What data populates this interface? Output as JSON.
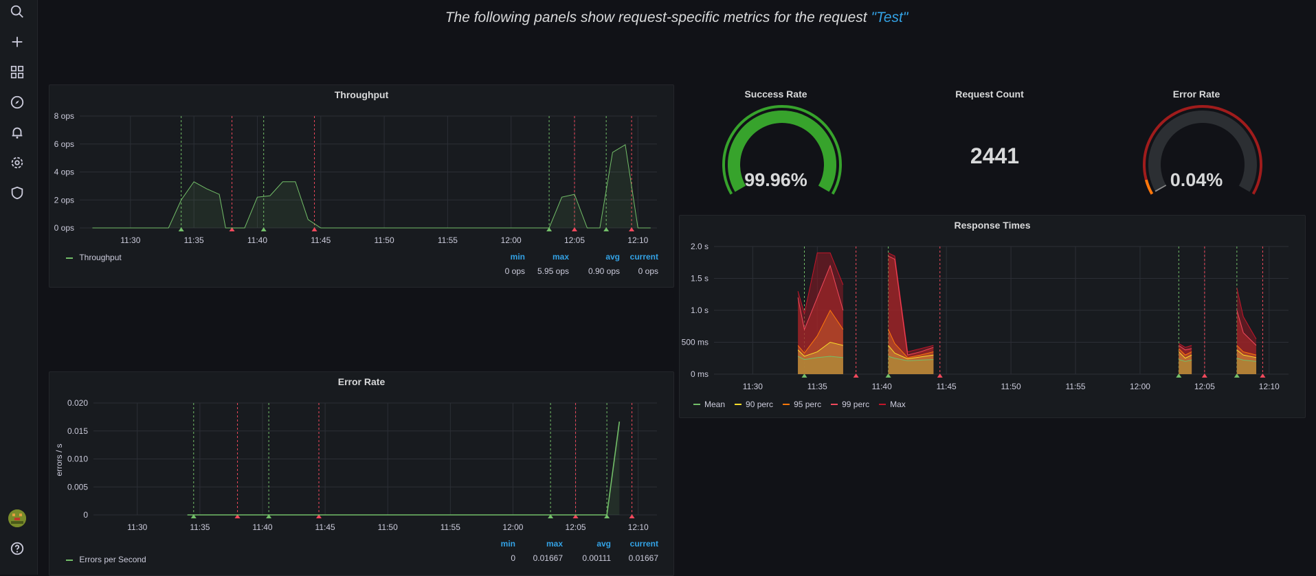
{
  "header": {
    "prefix": "The following panels show request-specific metrics for the request ",
    "request_name": "\"Test\""
  },
  "sidebar": {
    "items": [
      {
        "icon": "search-icon"
      },
      {
        "icon": "plus-icon"
      },
      {
        "icon": "dashboards-icon"
      },
      {
        "icon": "explore-icon"
      },
      {
        "icon": "alerting-bell-icon"
      },
      {
        "icon": "gear-icon"
      },
      {
        "icon": "shield-icon"
      }
    ],
    "bottom": [
      {
        "icon": "avatar"
      },
      {
        "icon": "help-icon"
      }
    ]
  },
  "colors": {
    "green": "#73bf69",
    "red": "#f2495c",
    "blue": "#33a2e5",
    "gauge_green": "#37a32c",
    "gauge_red": "#a01c1c",
    "gauge_orange": "#ff780a"
  },
  "time_ticks": [
    "11:30",
    "11:35",
    "11:40",
    "11:45",
    "11:50",
    "11:55",
    "12:00",
    "12:05",
    "12:10"
  ],
  "throughput": {
    "title": "Throughput",
    "legend": {
      "headers": [
        "min",
        "max",
        "avg",
        "current"
      ],
      "series_name": "Throughput",
      "values": [
        "0 ops",
        "5.95 ops",
        "0.90 ops",
        "0 ops"
      ]
    },
    "chart_data": {
      "type": "area",
      "y_ticks": [
        "0 ops",
        "2 ops",
        "4 ops",
        "6 ops",
        "8 ops"
      ],
      "ylim": [
        0,
        8
      ],
      "x": [
        "11:27:00",
        "11:33:00",
        "11:34:00",
        "11:35:00",
        "11:36:00",
        "11:37:00",
        "11:37:30",
        "11:38:00",
        "11:39:00",
        "11:40:00",
        "11:41:00",
        "11:42:00",
        "11:43:00",
        "11:44:00",
        "11:45:00",
        "11:46:00",
        "12:02:00",
        "12:03:00",
        "12:04:00",
        "12:05:00",
        "12:06:00",
        "12:07:00",
        "12:08:00",
        "12:09:00",
        "12:10:00",
        "12:11:00"
      ],
      "series": [
        {
          "name": "Throughput",
          "values": [
            0,
            0,
            2.0,
            3.3,
            2.8,
            2.4,
            0,
            0,
            0,
            2.2,
            2.3,
            3.3,
            3.3,
            0.6,
            0,
            0,
            0,
            0,
            2.2,
            2.4,
            0,
            0,
            5.4,
            5.95,
            0,
            0
          ]
        }
      ],
      "annotations_green": [
        "11:34:00",
        "11:40:30",
        "12:03:00",
        "12:07:30"
      ],
      "annotations_red": [
        "11:38:00",
        "11:44:30",
        "12:05:00",
        "12:09:30"
      ]
    }
  },
  "error_rate": {
    "title": "Error Rate",
    "ylabel": "errors / s",
    "legend": {
      "headers": [
        "min",
        "max",
        "avg",
        "current"
      ],
      "series_name": "Errors per Second",
      "values": [
        "0",
        "0.01667",
        "0.00111",
        "0.01667"
      ]
    },
    "chart_data": {
      "type": "line",
      "y_ticks": [
        "0",
        "0.005",
        "0.010",
        "0.015",
        "0.020"
      ],
      "ylim": [
        0,
        0.02
      ],
      "x": [
        "11:34:00",
        "12:07:30",
        "12:08:30"
      ],
      "series": [
        {
          "name": "Errors per Second",
          "values": [
            0,
            0,
            0.01667
          ]
        }
      ],
      "annotations_green": [
        "11:34:30",
        "11:40:30",
        "12:03:00",
        "12:07:30"
      ],
      "annotations_red": [
        "11:38:00",
        "11:44:30",
        "12:05:00",
        "12:09:30"
      ]
    }
  },
  "success_rate": {
    "title": "Success Rate",
    "value": "99.96%",
    "fraction": 0.9996
  },
  "request_count": {
    "title": "Request Count",
    "value": "2441"
  },
  "error_rate_gauge": {
    "title": "Error Rate",
    "value": "0.04%",
    "fraction": 0.0004
  },
  "response_times": {
    "title": "Response Times",
    "legend": [
      "Mean",
      "90 perc",
      "95 perc",
      "99 perc",
      "Max"
    ],
    "legend_colors": [
      "#73bf69",
      "#fade2a",
      "#ff780a",
      "#f2495c",
      "#c4162a"
    ],
    "chart_data": {
      "type": "area",
      "y_ticks": [
        "0 ms",
        "500 ms",
        "1.0 s",
        "1.5 s",
        "2.0 s"
      ],
      "ylim": [
        0,
        2000
      ],
      "x": [
        "11:33:30",
        "11:34:00",
        "11:35:00",
        "11:36:00",
        "11:37:00",
        "11:37:30",
        "11:40:30",
        "11:41:00",
        "11:42:00",
        "11:43:00",
        "11:44:00",
        "11:44:30",
        "12:03:00",
        "12:03:30",
        "12:04:00",
        "12:05:00",
        "12:07:30",
        "12:08:00",
        "12:09:00"
      ],
      "series": [
        {
          "name": "Max",
          "values": [
            1300,
            950,
            1900,
            1900,
            1400,
            0,
            1900,
            1850,
            350,
            400,
            450,
            0,
            480,
            420,
            450,
            0,
            1350,
            900,
            550
          ]
        },
        {
          "name": "99 perc",
          "values": [
            1200,
            700,
            1200,
            1700,
            1000,
            0,
            1850,
            1800,
            300,
            350,
            420,
            0,
            450,
            380,
            400,
            0,
            1000,
            650,
            450
          ]
        },
        {
          "name": "95 perc",
          "values": [
            450,
            330,
            600,
            1000,
            700,
            0,
            700,
            480,
            260,
            300,
            350,
            0,
            400,
            300,
            350,
            0,
            450,
            350,
            300
          ]
        },
        {
          "name": "90 perc",
          "values": [
            380,
            280,
            350,
            500,
            450,
            0,
            450,
            330,
            240,
            270,
            300,
            0,
            350,
            250,
            300,
            0,
            380,
            300,
            260
          ]
        },
        {
          "name": "Mean",
          "values": [
            280,
            230,
            260,
            280,
            260,
            0,
            280,
            250,
            210,
            220,
            230,
            0,
            230,
            200,
            220,
            0,
            250,
            220,
            200
          ]
        }
      ],
      "annotations_green": [
        "11:34:00",
        "11:40:30",
        "12:03:00",
        "12:07:30"
      ],
      "annotations_red": [
        "11:38:00",
        "11:44:30",
        "12:05:00",
        "12:09:30"
      ]
    }
  }
}
